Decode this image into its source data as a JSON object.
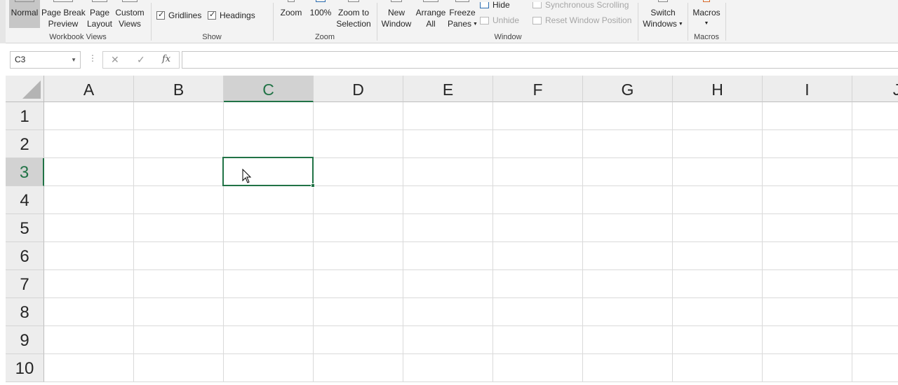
{
  "ribbon": {
    "workbook_views": {
      "label": "Workbook Views",
      "normal": "Normal",
      "page_break_1": "Page Break",
      "page_break_2": "Preview",
      "page_layout_1": "Page",
      "page_layout_2": "Layout",
      "custom_views_1": "Custom",
      "custom_views_2": "Views"
    },
    "show": {
      "label": "Show",
      "gridlines": "Gridlines",
      "headings": "Headings"
    },
    "zoom": {
      "label": "Zoom",
      "zoom": "Zoom",
      "hundred": "100%",
      "zoom_sel_1": "Zoom to",
      "zoom_sel_2": "Selection"
    },
    "window": {
      "label": "Window",
      "new_window_1": "New",
      "new_window_2": "Window",
      "arrange_1": "Arrange",
      "arrange_2": "All",
      "freeze_1": "Freeze",
      "freeze_2": "Panes",
      "hide": "Hide",
      "unhide": "Unhide",
      "sync_scroll": "Synchronous Scrolling",
      "reset_pos": "Reset Window Position",
      "switch_1": "Switch",
      "switch_2": "Windows"
    },
    "macros": {
      "label": "Macros",
      "macros": "Macros"
    }
  },
  "formula_bar": {
    "name_box": "C3",
    "cancel_icon": "✕",
    "enter_icon": "✓",
    "fx": "fx",
    "formula": ""
  },
  "sheet": {
    "columns": [
      "A",
      "B",
      "C",
      "D",
      "E",
      "F",
      "G",
      "H",
      "I",
      "J"
    ],
    "rows": [
      "1",
      "2",
      "3",
      "4",
      "5",
      "6",
      "7",
      "8",
      "9",
      "10"
    ],
    "selected_column": "C",
    "selected_row": "3",
    "active_cell": "C3"
  },
  "colors": {
    "accent": "#217346",
    "ribbon_bg": "#f3f3f3",
    "header_bg": "#ededed",
    "header_selected_bg": "#d2d2d2"
  }
}
